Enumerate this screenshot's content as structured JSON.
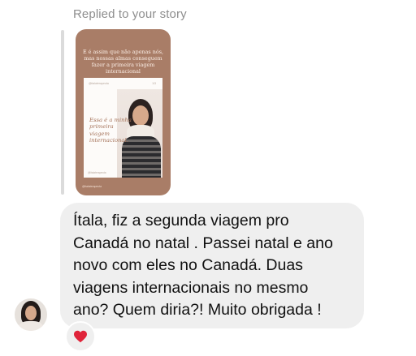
{
  "header": {
    "label": "Replied to your story"
  },
  "story": {
    "top_text": "E é assim que não apenas nós, mas nossas almas conseguem fazer a primeira viagem internacional",
    "card_handle": "@italaterapeuta",
    "card_page": "1/3",
    "card_title": "Essa é a minha primeira viagem internacional.",
    "card_footer": "@italaterapeuta",
    "bottom_handle": "@italaterapeuta"
  },
  "message": {
    "lines": [
      "Ítala, fiz a segunda viagem pro",
      "Canadá no natal . Passei natal e ano",
      "novo com eles no Canadá. Duas",
      "viagens internacionais no mesmo",
      "ano? Quem diria?! Muito obrigada !"
    ]
  },
  "reaction": {
    "emoji": "heart-icon",
    "color": "#e0243a"
  },
  "colors": {
    "bubble": "#efefef",
    "story_bg": "#a97d67",
    "accent_text": "#a5735a"
  }
}
